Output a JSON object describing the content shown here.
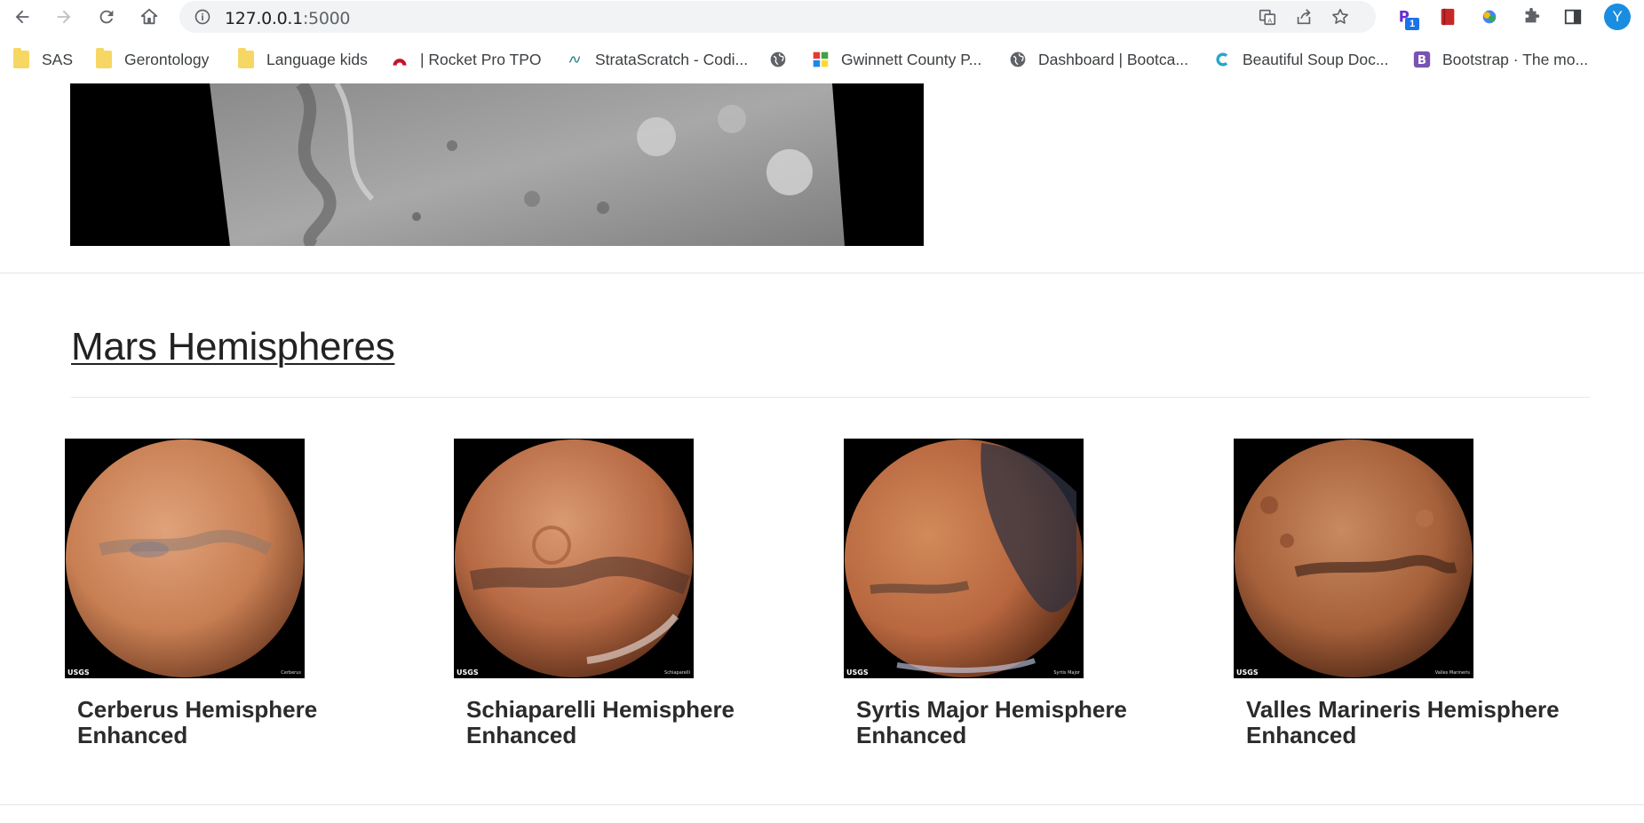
{
  "browser": {
    "url_host": "127.0.0.1",
    "url_port": ":5000",
    "profile_initial": "Y",
    "extension_badge": "1",
    "bookmarks": [
      {
        "label": "SAS",
        "icon": "folder-icon"
      },
      {
        "label": "Gerontology",
        "icon": "folder-icon"
      },
      {
        "label": "Language kids",
        "icon": "folder-icon"
      },
      {
        "label": "| Rocket Pro TPO",
        "icon": "rocket-logo-icon"
      },
      {
        "label": "StrataScratch - Codi...",
        "icon": "stratascratch-icon"
      },
      {
        "label": "",
        "icon": "globe-icon"
      },
      {
        "label": "Gwinnett County P...",
        "icon": "gwinnett-icon"
      },
      {
        "label": "Dashboard | Bootca...",
        "icon": "globe-icon"
      },
      {
        "label": "Beautiful Soup Doc...",
        "icon": "c-logo-icon"
      },
      {
        "label": "Bootstrap · The mo...",
        "icon": "bootstrap-icon"
      }
    ]
  },
  "page": {
    "hemispheres_title": "Mars Hemispheres",
    "hemispheres": [
      {
        "title": "Cerberus Hemisphere Enhanced",
        "thumb_label": "Cerberus"
      },
      {
        "title": "Schiaparelli Hemisphere Enhanced",
        "thumb_label": "Schiaparelli"
      },
      {
        "title": "Syrtis Major Hemisphere Enhanced",
        "thumb_label": "Syrtis Major"
      },
      {
        "title": "Valles Marineris Hemisphere Enhanced",
        "thumb_label": "Valles Marineris"
      }
    ],
    "thumb_logo": "USGS"
  },
  "colors": {
    "mars_light": "#d48a5c",
    "mars_mid": "#b8673f",
    "mars_dark": "#6e3a22",
    "accent_blue": "#1a73e8"
  }
}
